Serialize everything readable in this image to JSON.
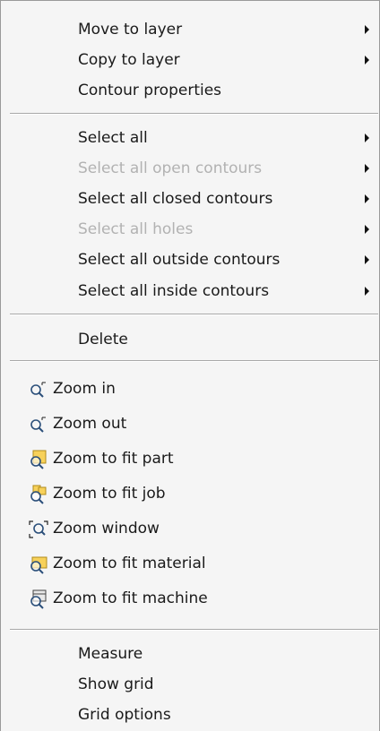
{
  "menu": {
    "items": [
      {
        "label": "Move to layer",
        "submenu": true,
        "enabled": true
      },
      {
        "label": "Copy to layer",
        "submenu": true,
        "enabled": true
      },
      {
        "label": "Contour properties",
        "submenu": false,
        "enabled": true
      },
      {
        "label": "Select all",
        "submenu": true,
        "enabled": true
      },
      {
        "label": "Select all open contours",
        "submenu": true,
        "enabled": false
      },
      {
        "label": "Select all closed contours",
        "submenu": true,
        "enabled": true
      },
      {
        "label": "Select all holes",
        "submenu": true,
        "enabled": false
      },
      {
        "label": "Select all outside contours",
        "submenu": true,
        "enabled": true
      },
      {
        "label": "Select all inside contours",
        "submenu": true,
        "enabled": true
      },
      {
        "label": "Delete",
        "submenu": false,
        "enabled": true
      },
      {
        "label": "Zoom in",
        "icon": "zoom-in-icon",
        "enabled": true
      },
      {
        "label": "Zoom out",
        "icon": "zoom-out-icon",
        "enabled": true
      },
      {
        "label": "Zoom to fit part",
        "icon": "zoom-fit-part-icon",
        "enabled": true
      },
      {
        "label": "Zoom to fit job",
        "icon": "zoom-fit-job-icon",
        "enabled": true
      },
      {
        "label": "Zoom window",
        "icon": "zoom-window-icon",
        "enabled": true
      },
      {
        "label": "Zoom to fit material",
        "icon": "zoom-fit-material-icon",
        "enabled": true
      },
      {
        "label": "Zoom to fit machine",
        "icon": "zoom-fit-machine-icon",
        "enabled": true
      },
      {
        "label": "Measure",
        "submenu": false,
        "enabled": true
      },
      {
        "label": "Show grid",
        "submenu": false,
        "enabled": true
      },
      {
        "label": "Grid options",
        "submenu": false,
        "enabled": true
      }
    ]
  },
  "colors": {
    "disabled_text": "#b2b2b2",
    "icon_yellow": "#f7d15a"
  }
}
